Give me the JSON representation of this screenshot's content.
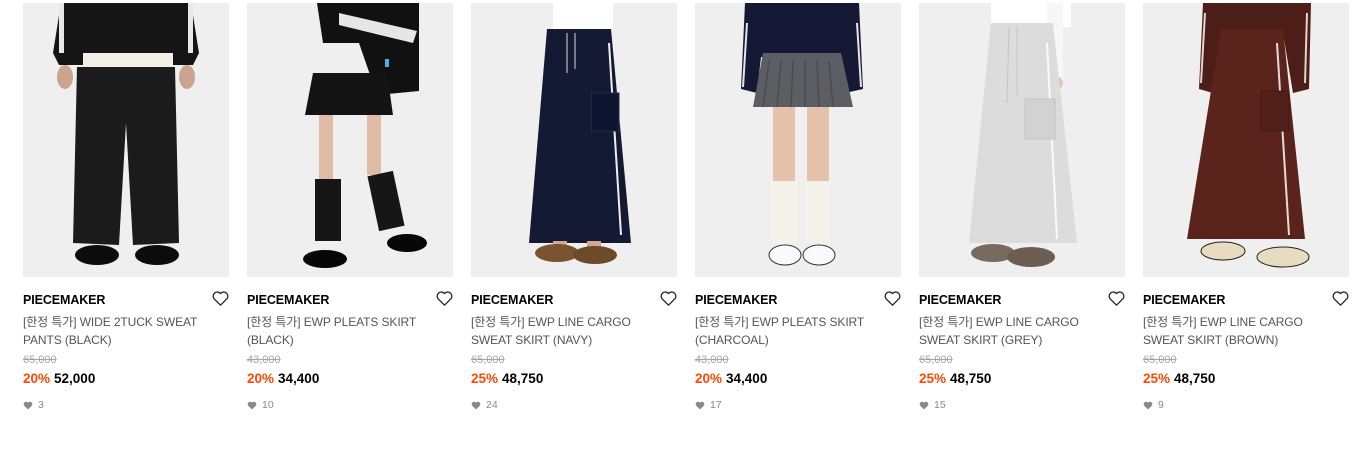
{
  "products": [
    {
      "brand": "PIECEMAKER",
      "name": "[한정 특가] WIDE 2TUCK SWEAT PANTS (BLACK)",
      "original_price": "65,000",
      "discount": "20%",
      "price": "52,000",
      "likes": "3",
      "item_color": "#1b1b1b",
      "item_type": "pants"
    },
    {
      "brand": "PIECEMAKER",
      "name": "[한정 특가] EWP PLEATS SKIRT (BLACK)",
      "original_price": "43,000",
      "discount": "20%",
      "price": "34,400",
      "likes": "10",
      "item_color": "#141414",
      "item_type": "mini-skirt"
    },
    {
      "brand": "PIECEMAKER",
      "name": "[한정 특가] EWP LINE CARGO SWEAT SKIRT (NAVY)",
      "original_price": "65,000",
      "discount": "25%",
      "price": "48,750",
      "likes": "24",
      "item_color": "#141a33",
      "item_type": "long-skirt"
    },
    {
      "brand": "PIECEMAKER",
      "name": "[한정 특가] EWP PLEATS SKIRT (CHARCOAL)",
      "original_price": "43,000",
      "discount": "20%",
      "price": "34,400",
      "likes": "17",
      "item_color": "#5d5e63",
      "item_type": "mini-skirt"
    },
    {
      "brand": "PIECEMAKER",
      "name": "[한정 특가] EWP LINE CARGO SWEAT SKIRT (GREY)",
      "original_price": "65,000",
      "discount": "25%",
      "price": "48,750",
      "likes": "15",
      "item_color": "#dcdcdc",
      "item_type": "long-skirt"
    },
    {
      "brand": "PIECEMAKER",
      "name": "[한정 특가] EWP LINE CARGO SWEAT SKIRT (BROWN)",
      "original_price": "65,000",
      "discount": "25%",
      "price": "48,750",
      "likes": "9",
      "item_color": "#5a241c",
      "item_type": "long-skirt"
    }
  ],
  "colors": {
    "discount": "#ff4800",
    "original_price": "#a5a5a5",
    "likes": "#8a8a8a",
    "image_bg": "#efefef"
  },
  "icons": {
    "wishlist": "heart-outline-icon",
    "like_count": "heart-filled-icon"
  }
}
